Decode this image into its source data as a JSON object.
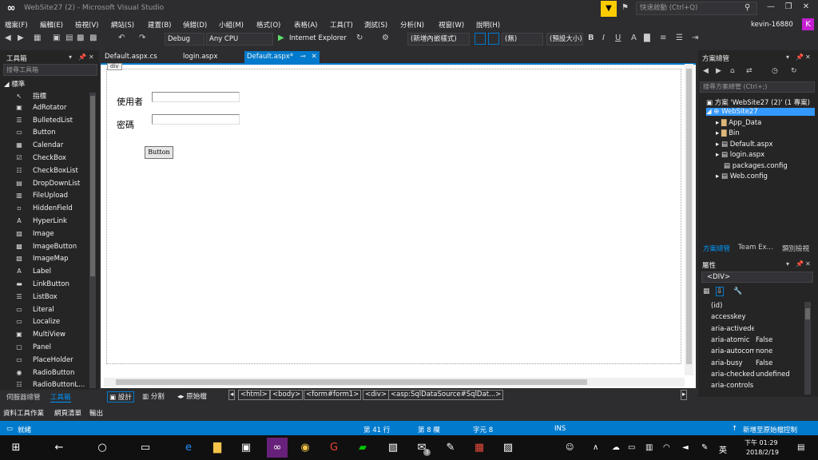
{
  "window": {
    "title": "WebSite27 (2) - Microsoft Visual Studio",
    "quick_launch": "快速啟動 (Ctrl+Q)",
    "user": "kevin-16880",
    "avatar_letter": "K"
  },
  "menu": [
    "檔案(F)",
    "編輯(E)",
    "檢視(V)",
    "網站(S)",
    "建置(B)",
    "偵錯(D)",
    "小組(M)",
    "格式(O)",
    "表格(A)",
    "工具(T)",
    "測試(S)",
    "分析(N)",
    "視窗(W)",
    "說明(H)"
  ],
  "toolbar": {
    "config": "Debug",
    "platform": "Any CPU",
    "browser": "Internet Explorer",
    "style": "(新增內嵌樣式)",
    "none": "(無)",
    "font_size": "(預設大小)"
  },
  "toolbox": {
    "title": "工具箱",
    "search": "搜尋工具箱",
    "section": "標準",
    "items": [
      {
        "label": "指標",
        "icon": "↖"
      },
      {
        "label": "AdRotator",
        "icon": "▣"
      },
      {
        "label": "BulletedList",
        "icon": "☰"
      },
      {
        "label": "Button",
        "icon": "▭"
      },
      {
        "label": "Calendar",
        "icon": "▦"
      },
      {
        "label": "CheckBox",
        "icon": "☑"
      },
      {
        "label": "CheckBoxList",
        "icon": "☷"
      },
      {
        "label": "DropDownList",
        "icon": "▤"
      },
      {
        "label": "FileUpload",
        "icon": "▥"
      },
      {
        "label": "HiddenField",
        "icon": "▫"
      },
      {
        "label": "HyperLink",
        "icon": "A"
      },
      {
        "label": "Image",
        "icon": "▨"
      },
      {
        "label": "ImageButton",
        "icon": "▩"
      },
      {
        "label": "ImageMap",
        "icon": "▧"
      },
      {
        "label": "Label",
        "icon": "A"
      },
      {
        "label": "LinkButton",
        "icon": "▬"
      },
      {
        "label": "ListBox",
        "icon": "☰"
      },
      {
        "label": "Literal",
        "icon": "▭"
      },
      {
        "label": "Localize",
        "icon": "▭"
      },
      {
        "label": "MultiView",
        "icon": "▣"
      },
      {
        "label": "Panel",
        "icon": "▢"
      },
      {
        "label": "PlaceHolder",
        "icon": "▭"
      },
      {
        "label": "RadioButton",
        "icon": "◉"
      },
      {
        "label": "RadioButtonL...",
        "icon": "☷"
      }
    ]
  },
  "left_tabs": [
    "伺服器總管",
    "工具箱"
  ],
  "doc_tabs": [
    "Default.aspx.cs",
    "login.aspx",
    "Default.aspx*"
  ],
  "design": {
    "div_tag": "div",
    "user_label": "使用者",
    "pwd_label": "密碼",
    "button": "Button"
  },
  "viewbar": {
    "design": "設計",
    "split": "分割",
    "source": "原始檔"
  },
  "breadcrumbs": [
    "<html>",
    "<body>",
    "<form#form1>",
    "<div>",
    "<asp:SqlDataSource#SqlDat...>"
  ],
  "solution": {
    "title": "方案總管",
    "search": "搜尋方案總管 (Ctrl+;)",
    "tree": [
      "方案 'WebSite27 (2)' (1 專案)",
      "WebSite27",
      "App_Data",
      "Bin",
      "Default.aspx",
      "login.aspx",
      "packages.config",
      "Web.config"
    ],
    "tabs": [
      "方案總管",
      "Team Ex...",
      "類別檢視"
    ]
  },
  "properties": {
    "title": "屬性",
    "object": "<DIV>",
    "rows": [
      {
        "name": "(id)",
        "value": ""
      },
      {
        "name": "accesskey",
        "value": ""
      },
      {
        "name": "aria-activedes",
        "value": ""
      },
      {
        "name": "aria-atomic",
        "value": "False"
      },
      {
        "name": "aria-autocomp",
        "value": "none"
      },
      {
        "name": "aria-busy",
        "value": "False"
      },
      {
        "name": "aria-checked",
        "value": "undefined"
      },
      {
        "name": "aria-controls",
        "value": ""
      }
    ]
  },
  "bottom_tabs": [
    "資料工具作業",
    "網頁清單",
    "輸出"
  ],
  "status": {
    "ready": "就緒",
    "line": "第 41 行",
    "col": "第 8 欄",
    "ch": "字元 8",
    "ins": "INS",
    "source_control": "新增至原始檔控制"
  },
  "taskbar": {
    "ime": "英",
    "time": "下午 01:29",
    "date": "2018/2/19",
    "mail_badge": "3"
  },
  "colors": {
    "accent": "#007acc",
    "chrome": "#2d2d30",
    "panel": "#252526",
    "avatar": "#c51fd2",
    "filter": "#ffcc00"
  }
}
